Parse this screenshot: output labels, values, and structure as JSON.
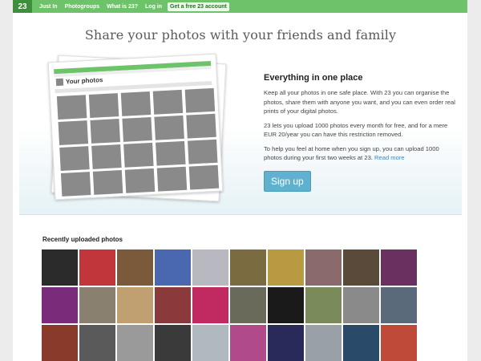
{
  "nav": {
    "logo": "23",
    "links": [
      "Just In",
      "Photogroups",
      "What is 23?",
      "Log in"
    ],
    "cta": "Get a free 23 account"
  },
  "hero": {
    "headline": "Share your photos with your friends and family",
    "preview_title": "Your photos"
  },
  "feature": {
    "title": "Everything in one place",
    "p1": "Keep all your photos in one safe place. With 23 you can organise the photos, share them with anyone you want, and you can even order real prints of your digital photos.",
    "p2": "23 lets you upload 1000 photos every month for free, and for a mere EUR 20/year you can have this restriction removed.",
    "p3": "To help you feel at home when you sign up, you can upload 1000 photos during your first two weeks at 23.",
    "read_more": "Read more",
    "signup": "Sign up"
  },
  "recent": {
    "title": "Recently uploaded photos",
    "thumb_colors": [
      "#2b2b2b",
      "#c0363a",
      "#7a5a3a",
      "#4a68b0",
      "#b8b8c0",
      "#7a6c40",
      "#b89a40",
      "#8a6a6a",
      "#5a4a3a",
      "#6a3060",
      "#7a2c7a",
      "#8a8070",
      "#c0a070",
      "#8a3a3a",
      "#c02a60",
      "#6a6a5a",
      "#1a1a1a",
      "#7a8a5a",
      "#8a8a8a",
      "#5a6a7a",
      "#8a3a2a",
      "#5a5a5a",
      "#9a9a9a",
      "#3a3a3a",
      "#b0b8c0",
      "#b04a8a",
      "#2a2a5a",
      "#9aa0a8",
      "#2a4a6a",
      "#c04a3a"
    ]
  }
}
